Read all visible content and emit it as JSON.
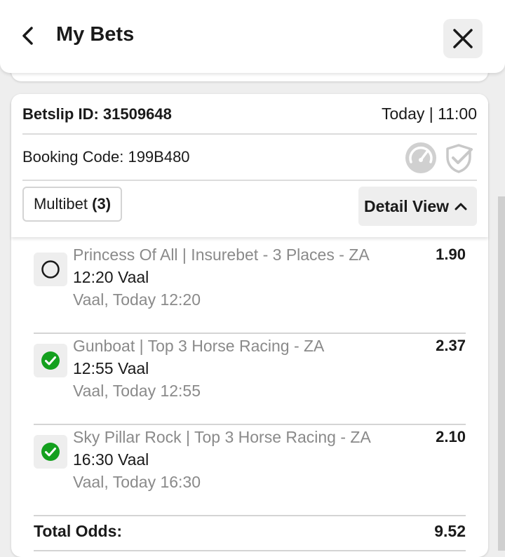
{
  "header": {
    "title": "My Bets"
  },
  "betslip": {
    "id_label": "Betslip ID:",
    "id": "31509648",
    "time": "Today | 11:00",
    "booking_label": "Booking Code:",
    "booking_code": "199B480",
    "bet_type": "Multibet",
    "selection_count": "(3)",
    "view_label": "Detail View"
  },
  "selections": [
    {
      "name": "Princess Of All | Insurebet - 3 Places - ZA",
      "event": "12:20 Vaal",
      "date": "Vaal, Today 12:20",
      "odds": "1.90",
      "status": "pending"
    },
    {
      "name": "Gunboat | Top 3 Horse Racing - ZA",
      "event": "12:55 Vaal",
      "date": "Vaal, Today 12:55",
      "odds": "2.37",
      "status": "won"
    },
    {
      "name": "Sky Pillar Rock | Top 3 Horse Racing - ZA",
      "event": "16:30 Vaal",
      "date": "Vaal, Today 16:30",
      "odds": "2.10",
      "status": "won"
    }
  ],
  "total": {
    "label": "Total Odds:",
    "value": "9.52"
  },
  "colors": {
    "won": "#14a01e",
    "muted": "#8a8a8a",
    "icon_grey": "#c8c8c8"
  },
  "icons": [
    "back-arrow-icon",
    "close-icon",
    "cashout-gauge-icon",
    "shield-check-icon",
    "pending-circle-icon",
    "won-check-icon",
    "chevron-up-icon"
  ]
}
